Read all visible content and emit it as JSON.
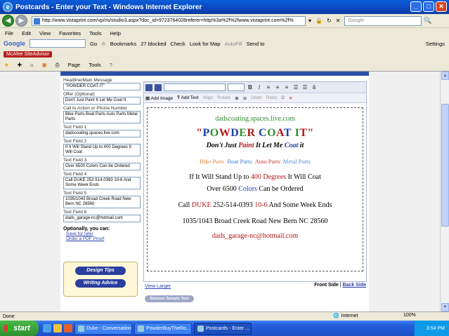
{
  "window": {
    "title": "Postcards - Enter your Text - Windows Internet Explorer",
    "address": "http://www.vistaprint.com/vp/ns/studio3.aspx?doc_id=9723764028referer=http%3a%2f%2fwww.vistaprint.com%2f%",
    "search_placeholder": "Google",
    "go_label": "Go"
  },
  "menu": [
    "File",
    "Edit",
    "View",
    "Favorites",
    "Tools",
    "Help"
  ],
  "googlebar": {
    "logo": "Google",
    "go": "Go",
    "bookmarks": "Bookmarks",
    "blocked": "27 blocked",
    "check": "Check",
    "lookfor": "Look for Map",
    "autofill": "AutoFill",
    "sendto": "Send to",
    "settings": "Settings"
  },
  "mcafee": "McAfee SiteAdvisor",
  "favbar": {
    "page": "Page",
    "tools": "Tools"
  },
  "form": {
    "headline_label": "Headline/Main Message",
    "headline_value": "\"POWDER COAT IT\"",
    "offer_label": "Offer (Optional)",
    "offer_value": "Don't Just Paint It Let Me Coat It",
    "cta_label": "Call to Action or Phone Number",
    "cta_value": "Bike Parts   Boat Parts   Auto Parts   Metal Parts",
    "t1_label": "Text Field 1",
    "t1_value": "dadscoating.spaces.live.com",
    "t2_label": "Text Field 2",
    "t2_value": "If It Will Stand Up to 400 Degrees It Will Coat",
    "t3_label": "Text Field 3",
    "t3_value": "Over 6500 Colors Can be Ordered",
    "t4_label": "Text Field 4",
    "t4_value": "Call DUKE 252-514-0393 10-6 And Some Week Ends",
    "t5_label": "Text Field 5",
    "t5_value": "1035/1043 Broad Creek Road New Bern NC 28560",
    "t6_label": "Text Field 6",
    "t6_value": "dads_garage-nc@hotmail.com",
    "optional_label": "Optionally, you can:",
    "save_link": "Save for later",
    "proof_link": "Order a PDF Proof",
    "design_tips": "Design Tips",
    "writing_advice": "Writing Advice"
  },
  "toolbar": {
    "add_image": "Add Image",
    "add_text": "Add Text",
    "align": "Align",
    "rotate": "Rotate",
    "undo": "Undo",
    "redo": "Redo"
  },
  "card": {
    "site": "dadscoating.spaces.live.com",
    "headline_letters": [
      "\"",
      "P",
      "O",
      "W",
      "D",
      "E",
      "R",
      " ",
      "C",
      "O",
      "A",
      "T",
      " ",
      "I",
      "T",
      "\""
    ],
    "slogan_a": "Don't Just ",
    "slogan_paint": "Paint",
    "slogan_b": " It Let Me ",
    "slogan_coat": "Coat",
    "slogan_c": " it",
    "parts": [
      {
        "label": "Bike Parts",
        "color": "#e8823a"
      },
      {
        "label": "Boat Parts",
        "color": "#3a7fd5"
      },
      {
        "label": "Auto Parts",
        "color": "#c8382c"
      },
      {
        "label": "Metal Parts",
        "color": "#4a8fd8"
      }
    ],
    "up_a": "If It Will Stand Up to ",
    "up_deg": "400 Degrees",
    "up_b": " It Will Coat",
    "over_a": "Over 6500 ",
    "over_colors": "Colors",
    "over_b": " Can be Ordered",
    "call_a": "Call ",
    "call_duke": "DUKE",
    "call_phone": " 252-514-0393 ",
    "call_hours": "10-6",
    "call_b": " And Some Week Ends",
    "address": "1035/1043 Broad Creek Road New Bern NC 28560",
    "email": "dads_garage-nc@hotmail.com"
  },
  "below": {
    "view_larger": "View Larger",
    "front_side": "Front Side",
    "sep": " | ",
    "back_side": "Back Side",
    "remove_sample": "Remove Sample Text"
  },
  "status": {
    "done": "Done",
    "zone": "Internet",
    "zoom": "100%"
  },
  "taskbar": {
    "start": "start",
    "tasks": [
      {
        "label": "Duke - Conversation",
        "active": false
      },
      {
        "label": "PowderBuyTheRo...",
        "active": false
      },
      {
        "label": "Postcards - Enter ...",
        "active": true
      }
    ],
    "clock": "3:54 PM"
  },
  "colors": {
    "headline": [
      "#b01818",
      "#1e3fa8",
      "#2e8f2e",
      "#b01818",
      "#1e3fa8",
      "#2e8f2e",
      "#b01818",
      "#000000",
      "#1e3fa8",
      "#2e8f2e",
      "#b01818",
      "#1e3fa8",
      "#000000",
      "#2e8f2e",
      "#b01818",
      "#b01818"
    ],
    "paint": "#b01818",
    "coat": "#1e3fa8",
    "degrees": "#b01818",
    "colors_word": "#1e3fa8",
    "duke": "#b01818",
    "hours": "#b01818"
  }
}
